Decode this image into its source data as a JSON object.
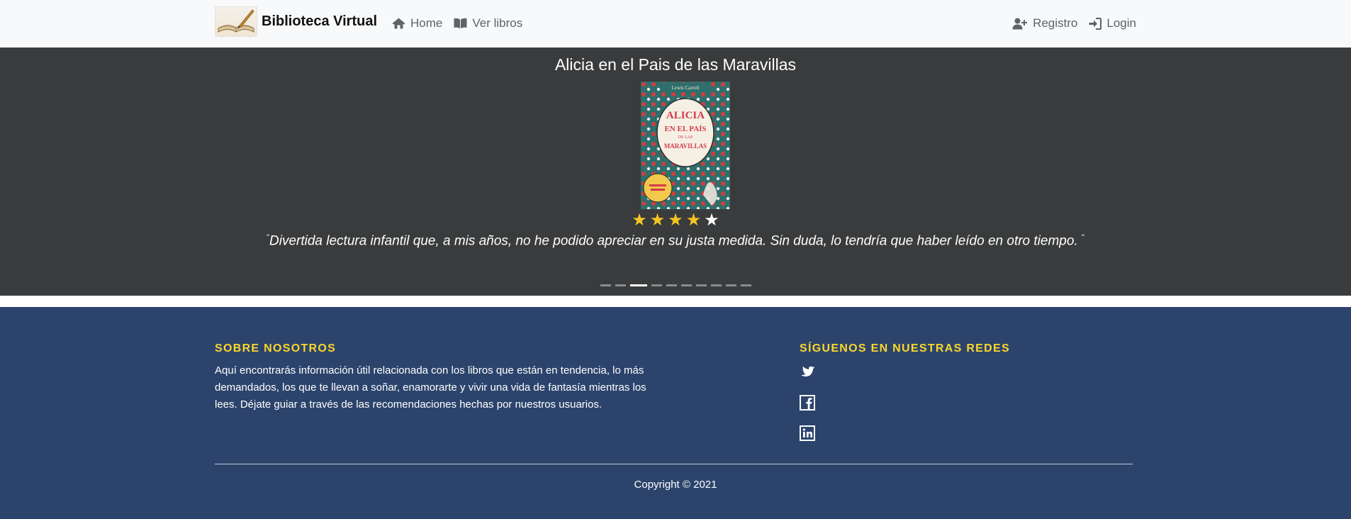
{
  "navbar": {
    "brand_name": "Biblioteca Virtual",
    "links": [
      {
        "label": "Home",
        "icon": "home-icon"
      },
      {
        "label": "Ver libros",
        "icon": "book-open-icon"
      }
    ],
    "right_links": [
      {
        "label": "Registro",
        "icon": "user-plus-icon"
      },
      {
        "label": "Login",
        "icon": "sign-in-icon"
      }
    ]
  },
  "carousel": {
    "title": "Alicia en el Pais de las Maravillas",
    "cover_lines": [
      "Lewis Carroll",
      "ALICIA",
      "EN EL PAÍS",
      "DE LAS",
      "MARAVILLAS"
    ],
    "rating": 4,
    "rating_max": 5,
    "review_open_quote": "\"",
    "review": "Divertida lectura infantil que, a mis años, no he podido apreciar en su justa medida. Sin duda, lo tendría que haber leído en otro tiempo. ",
    "review_close_quote": "\"",
    "slide_count": 10,
    "active_slide": 2
  },
  "footer": {
    "about_title": "SOBRE NOSOTROS",
    "about_text": "Aquí encontrarás información útil relacionada con los libros que están en tendencia, lo más demandados, los que te llevan a soñar, enamorarte y vivir una vida de fantasía mientras los lees. Déjate guiar a través de las recomendaciones hechas por nuestros usuarios.",
    "social_title": "SÍGUENOS EN NUESTRAS REDES",
    "social_icons": [
      "twitter-icon",
      "facebook-icon",
      "linkedin-icon"
    ],
    "copyright": "Copyright © 2021"
  },
  "colors": {
    "navbar_bg": "#f8f9fa",
    "carousel_bg": "#3a3b3c",
    "footer_bg": "#2c446c",
    "footer_heading": "#fcd72c",
    "star_filled": "#f7c521",
    "star_empty": "#ffffff"
  }
}
